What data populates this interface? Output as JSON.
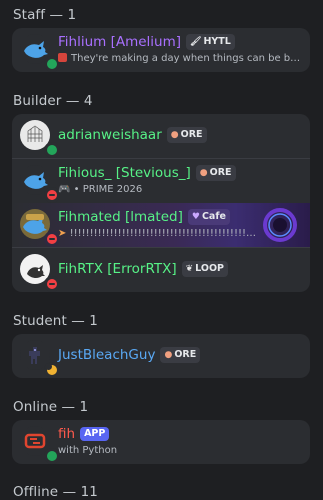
{
  "sections": {
    "staff": {
      "header": "Staff — 1"
    },
    "builder": {
      "header": "Builder — 4"
    },
    "student": {
      "header": "Student — 1"
    },
    "online": {
      "header": "Online — 1"
    },
    "offline": {
      "header": "Offline — 11"
    }
  },
  "members": {
    "fihlium": {
      "name": "Fihlium [Amelium]",
      "tag": "HYTL",
      "tag_icon": "brush-icon",
      "status_text": "They're making a day when things can be better and t...",
      "status_icon": "badge-icon",
      "name_color": "#a970ff",
      "presence": "online"
    },
    "adrian": {
      "name": "adrianweishaar",
      "tag": "ORE",
      "tag_icon": "ore-icon",
      "name_color": "#57f287",
      "presence": "online"
    },
    "fihious": {
      "name": "Fihious_ [Stevious_]",
      "tag": "ORE",
      "tag_icon": "ore-icon",
      "status_text": "PRIME 2026",
      "status_icon": "gamepad-icon",
      "status_prefix": "•",
      "name_color": "#57f287",
      "presence": "dnd"
    },
    "fihmated": {
      "name": "Fihmated [lmated]",
      "tag": "Cafe",
      "tag_icon": "heart-icon",
      "status_text": "!!!!!!!!!!!!!!!!!!!!!!!!!!!!!!!!!!!!!!!!!!!!!!!!!!!!!!!!!!!!!!!!!",
      "status_icon": "pointer-icon",
      "name_color": "#57f287",
      "presence": "dnd"
    },
    "fihrtx": {
      "name": "FihRTX [ErrorRTX]",
      "tag": "LOOP",
      "tag_icon": "leaf-icon",
      "name_color": "#57f287",
      "presence": "dnd"
    },
    "bleach": {
      "name": "JustBleachGuy",
      "tag": "ORE",
      "tag_icon": "ore-icon",
      "name_color": "#5aa9f5",
      "presence": "idle"
    },
    "fih": {
      "name": "fih",
      "tag": "APP",
      "status_text": "with Python",
      "name_color": "#ff5a4d",
      "presence": "online"
    }
  }
}
